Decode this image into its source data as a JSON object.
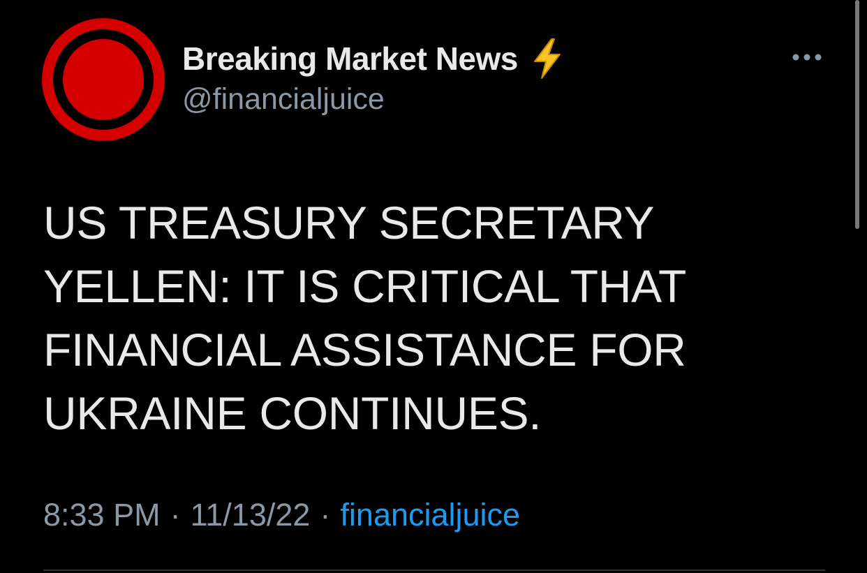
{
  "tweet": {
    "author": {
      "display_name": "Breaking Market News",
      "badge_icon": "lightning-bolt-icon",
      "handle": "@financialjuice",
      "avatar_icon": "red-ring-logo-icon"
    },
    "more_icon": "ellipsis-icon",
    "text_lines": [
      "US TREASURY SECRETARY",
      "YELLEN: IT IS CRITICAL THAT",
      "FINANCIAL ASSISTANCE FOR",
      "UKRAINE CONTINUES."
    ],
    "time": "8:33 PM",
    "separator": "·",
    "date": "11/13/22",
    "source": "financialjuice"
  },
  "colors": {
    "background": "#000000",
    "primary_text": "#e7e9ea",
    "secondary_text": "#8b98a5",
    "link": "#1d9bf0",
    "avatar_red": "#cc0000",
    "bolt_yellow": "#f5b700"
  }
}
